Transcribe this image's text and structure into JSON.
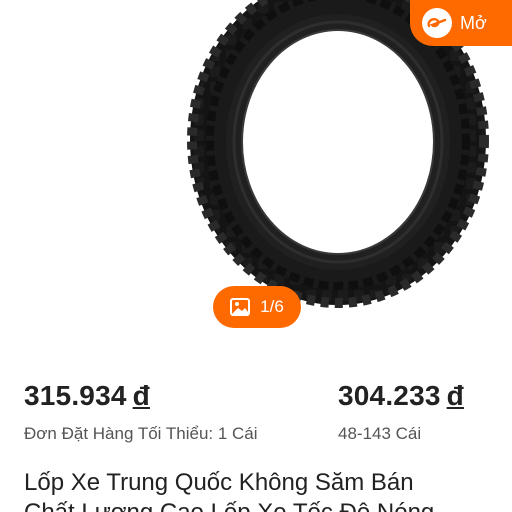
{
  "colors": {
    "accent": "#ff6a00",
    "text_primary": "#222222",
    "text_secondary": "#555555"
  },
  "gallery": {
    "open_app_label": "Mở",
    "open_app_icon": "alibaba-logo-icon",
    "counter_icon": "picture-icon",
    "counter_text": "1/6"
  },
  "pricing": {
    "min_order_price": "315.934",
    "min_order_currency": "đ",
    "min_order_note": "Đơn Đặt Hàng Tối Thiểu: 1 Cái",
    "bulk_price": "304.233",
    "bulk_currency": "đ",
    "bulk_note": "48-143 Cái"
  },
  "product": {
    "title_line1": "Lốp Xe Trung Quốc Không Săm Bán",
    "title_line2": "Chất Lượng Cao Lốp Xe Tốc Độ Nóng"
  }
}
